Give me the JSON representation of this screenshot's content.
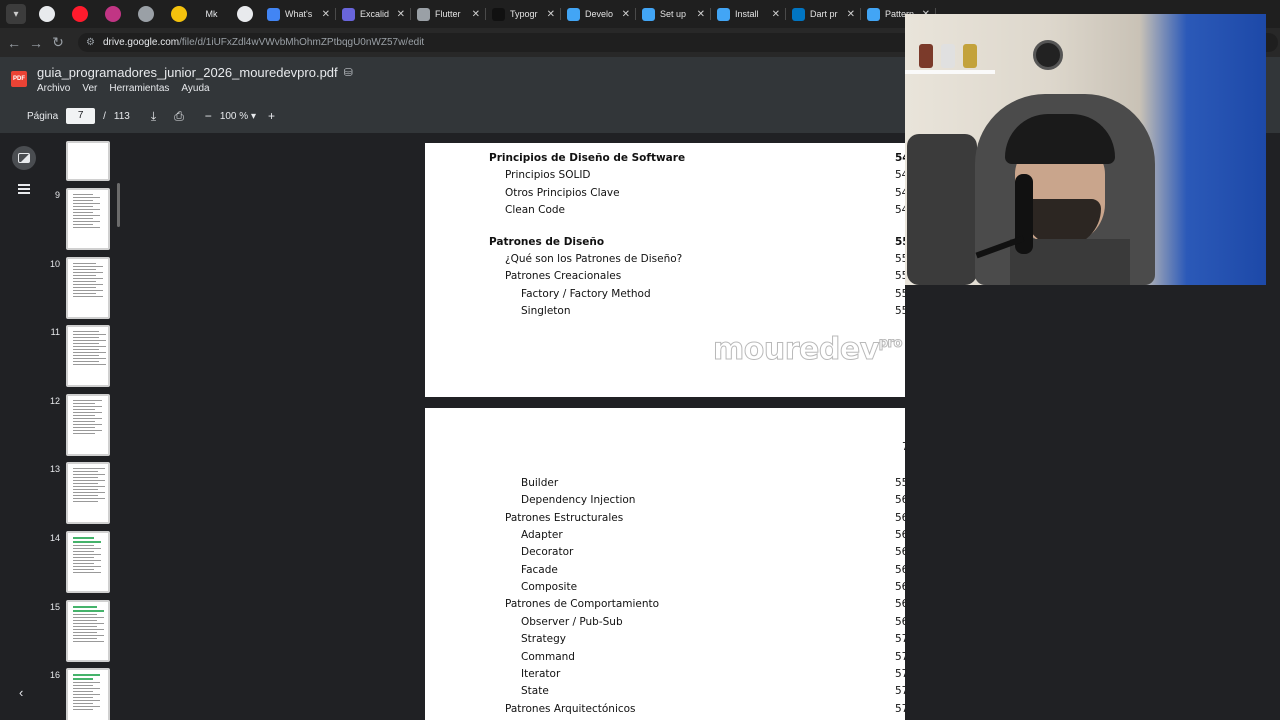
{
  "tabs": [
    {
      "title": "What's",
      "color": "#4285f4"
    },
    {
      "title": "Excalid",
      "color": "#6965db"
    },
    {
      "title": "Flutter",
      "color": "#9aa0a6"
    },
    {
      "title": "Typogr",
      "color": "#111111"
    },
    {
      "title": "Develo",
      "color": "#42a5f5"
    },
    {
      "title": "Set up",
      "color": "#42a5f5"
    },
    {
      "title": "Install",
      "color": "#42a5f5"
    },
    {
      "title": "Dart pr",
      "color": "#0175c2"
    },
    {
      "title": "Pattern",
      "color": "#42a5f5"
    }
  ],
  "pinned_tabs": [
    {
      "icon": "github-icon",
      "color": "#e8eaed"
    },
    {
      "icon": "opera-icon",
      "color": "#ff1b2d"
    },
    {
      "icon": "instagram-icon",
      "color": "#c13584"
    },
    {
      "icon": "generic-tab-icon",
      "color": "#9aa0a6"
    },
    {
      "icon": "duck-icon",
      "color": "#f4c20d"
    },
    {
      "icon": "mk-icon",
      "color": "#e8eaed"
    },
    {
      "icon": "bing-icon",
      "color": "#e8eaed"
    }
  ],
  "mk_label": "Mk",
  "address": {
    "host": "drive.google.com",
    "path": "/file/d/1iUFxZdl4wVWvbMhOhmZPtbqgU0nWZ57w/edit"
  },
  "file": {
    "name": "guia_programadores_junior_2026_mouredevpro.pdf",
    "badge": "PDF"
  },
  "menu": [
    "Archivo",
    "Ver",
    "Herramientas",
    "Ayuda"
  ],
  "toolbar": {
    "page_label": "Página",
    "current_page": "7",
    "separator": "/",
    "total_pages": "113",
    "zoom": "100 %"
  },
  "thumbnails": [
    "9",
    "10",
    "11",
    "12",
    "13",
    "14",
    "15",
    "16"
  ],
  "page_a": {
    "entries": [
      {
        "text": "Principios de Diseño de Software",
        "num": "54",
        "level": 0,
        "bold": true
      },
      {
        "text": "Principios SOLID",
        "num": "54",
        "level": 1,
        "bold": false
      },
      {
        "text": "Otros Principios Clave",
        "num": "54",
        "level": 1,
        "bold": false
      },
      {
        "text": "Clean Code",
        "num": "54",
        "level": 1,
        "bold": false
      },
      {
        "text": "Patrones de Diseño",
        "num": "55",
        "level": 0,
        "bold": true
      },
      {
        "text": "¿Qué son los Patrones de Diseño?",
        "num": "55",
        "level": 1,
        "bold": false
      },
      {
        "text": "Patrones Creacionales",
        "num": "55",
        "level": 1,
        "bold": false
      },
      {
        "text": "Factory / Factory Method",
        "num": "55",
        "level": 2,
        "bold": false
      },
      {
        "text": "Singleton",
        "num": "55",
        "level": 2,
        "bold": false
      }
    ],
    "logo": "mouredev",
    "logo_sup": "pro"
  },
  "page_b": {
    "page_number": "7",
    "entries": [
      {
        "text": "Builder",
        "num": "55",
        "level": 2
      },
      {
        "text": "Dependency Injection",
        "num": "56",
        "level": 2
      },
      {
        "text": "Patrones Estructurales",
        "num": "56",
        "level": 1
      },
      {
        "text": "Adapter",
        "num": "56",
        "level": 2
      },
      {
        "text": "Decorator",
        "num": "56",
        "level": 2
      },
      {
        "text": "Facade",
        "num": "56",
        "level": 2
      },
      {
        "text": "Composite",
        "num": "56",
        "level": 2
      },
      {
        "text": "Patrones de Comportamiento",
        "num": "56",
        "level": 1
      },
      {
        "text": "Observer / Pub-Sub",
        "num": "56",
        "level": 2
      },
      {
        "text": "Strategy",
        "num": "57",
        "level": 2
      },
      {
        "text": "Command",
        "num": "57",
        "level": 2
      },
      {
        "text": "Iterator",
        "num": "57",
        "level": 2
      },
      {
        "text": "State",
        "num": "57",
        "level": 2
      },
      {
        "text": "Patrones Arquitectónicos",
        "num": "57",
        "level": 1
      }
    ]
  }
}
